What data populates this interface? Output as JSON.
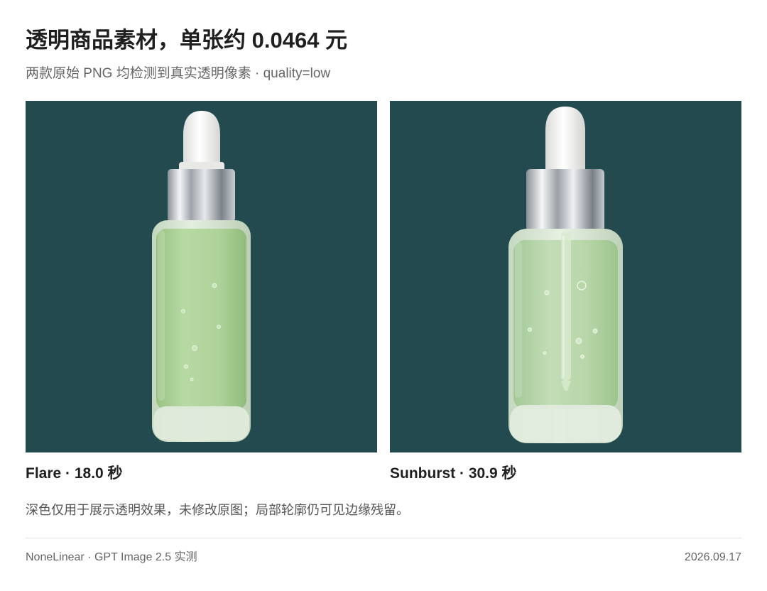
{
  "header": {
    "title": "透明商品素材，单张约 0.0464 元",
    "subtitle": "两款原始 PNG 均检测到真实透明像素 · quality=low"
  },
  "panels": [
    {
      "caption": "Flare · 18.0 秒",
      "background": "#234b4f",
      "image": "serum-dropper-bottle"
    },
    {
      "caption": "Sunburst · 30.9 秒",
      "background": "#234b4f",
      "image": "serum-dropper-bottle-with-pipette"
    }
  ],
  "note": "深色仅用于展示透明效果，未修改原图；局部轮廓仍可见边缘残留。",
  "footer": {
    "left": "NoneLinear · GPT Image 2.5 实测",
    "right": "2026.09.17"
  },
  "colors": {
    "panel_background": "#234b4f",
    "liquid": "#a9cf94",
    "glass": "#d8e7d2",
    "cap_silver": "#c9ced3",
    "bulb": "#f0f0ee"
  }
}
